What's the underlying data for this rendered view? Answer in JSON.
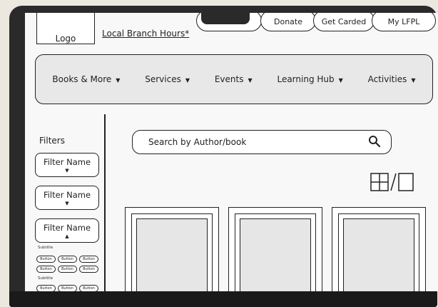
{
  "header": {
    "logo": "Logo",
    "branch_link": "Local Branch Hours*",
    "buttons": [
      "",
      "Donate",
      "Get Carded",
      "My LFPL"
    ]
  },
  "nav": [
    {
      "label": "Books & More"
    },
    {
      "label": "Services"
    },
    {
      "label": "Events"
    },
    {
      "label": "Learning Hub"
    },
    {
      "label": "Activities"
    }
  ],
  "sidebar": {
    "title": "Filters",
    "filters": [
      "Filter Name",
      "Filter Name",
      "Filter Name"
    ],
    "subtitle": "Subtitle",
    "button_label": "Button"
  },
  "search": {
    "placeholder": "Search by Author/book"
  },
  "colors": {
    "panel": "#e8e8e8",
    "ink": "#222222",
    "bezel": "#2a2a2a"
  }
}
